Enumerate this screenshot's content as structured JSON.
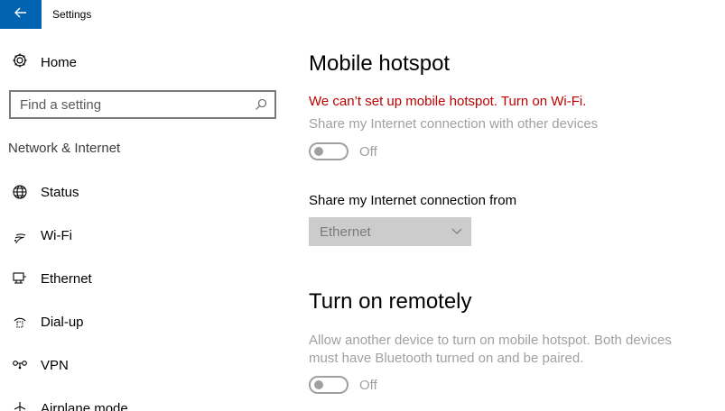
{
  "window": {
    "title": "Settings"
  },
  "nav": {
    "home_label": "Home",
    "search_placeholder": "Find a setting",
    "section_title": "Network & Internet",
    "items": [
      {
        "label": "Status",
        "icon": "globe-icon"
      },
      {
        "label": "Wi-Fi",
        "icon": "wifi-icon"
      },
      {
        "label": "Ethernet",
        "icon": "ethernet-icon"
      },
      {
        "label": "Dial-up",
        "icon": "dialup-icon"
      },
      {
        "label": "VPN",
        "icon": "vpn-icon"
      },
      {
        "label": "Airplane mode",
        "icon": "airplane-icon"
      }
    ]
  },
  "main": {
    "hotspot_title": "Mobile hotspot",
    "error_message": "We can’t set up mobile hotspot. Turn on Wi-Fi.",
    "share_desc": "Share my Internet connection with other devices",
    "share_toggle_state": "Off",
    "share_from_label": "Share my Internet connection from",
    "share_from_value": "Ethernet",
    "remote_title": "Turn on remotely",
    "remote_desc_line1": "Allow another device to turn on mobile hotspot. Both devices",
    "remote_desc_line2": "must have Bluetooth turned on and be paired.",
    "remote_toggle_state": "Off"
  },
  "colors": {
    "accent": "#0063b1",
    "error": "#c00000",
    "disabled_text": "#a0a0a0"
  }
}
